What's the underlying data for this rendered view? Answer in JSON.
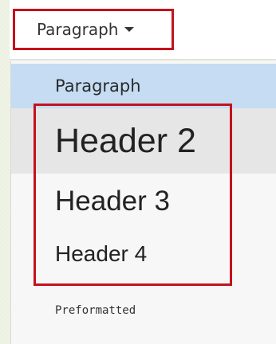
{
  "toolbar": {
    "format_dropdown_label": "Paragraph"
  },
  "menu": {
    "items": [
      {
        "label": "Paragraph"
      },
      {
        "label": "Header 2"
      },
      {
        "label": "Header 3"
      },
      {
        "label": "Header 4"
      },
      {
        "label": "Preformatted"
      }
    ]
  },
  "colors": {
    "highlight_border": "#c4121c",
    "selected_item_bg": "#c5dcf3",
    "hovered_item_bg": "#e6e6e6"
  }
}
